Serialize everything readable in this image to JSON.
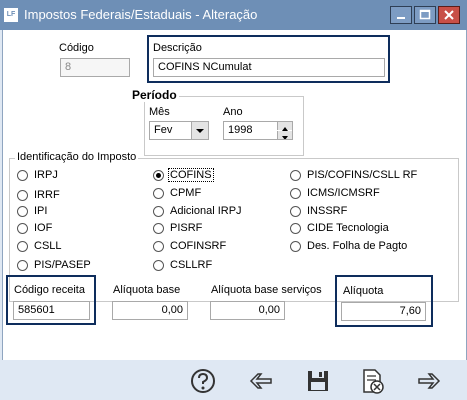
{
  "window": {
    "title": "Impostos Federais/Estaduais - Alteração",
    "app_icon": "LF"
  },
  "codigo": {
    "label": "Código",
    "value": "8"
  },
  "descricao": {
    "label": "Descrição",
    "value": "COFINS NCumulat"
  },
  "periodo": {
    "title": "Período",
    "mes_label": "Mês",
    "mes_value": "Fev",
    "ano_label": "Ano",
    "ano_value": "1998"
  },
  "identificacao": {
    "title": "Identificação do Imposto",
    "selected": "COFINS",
    "col1": [
      "IRPJ",
      "IRRF",
      "IPI",
      "IOF",
      "CSLL",
      "PIS/PASEP"
    ],
    "col2": [
      "COFINS",
      "CPMF",
      "Adicional IRPJ",
      "PISRF",
      "COFINSRF",
      "CSLLRF"
    ],
    "col3": [
      "PIS/COFINS/CSLL RF",
      "ICMS/ICMSRF",
      "INSSRF",
      "CIDE Tecnologia",
      "Des. Folha de Pagto"
    ]
  },
  "codigo_receita": {
    "label": "Código receita",
    "value": "585601"
  },
  "aliquota_base": {
    "label": "Alíquota base",
    "value": "0,00"
  },
  "aliquota_base_servicos": {
    "label": "Alíquota base serviços",
    "value": "0,00"
  },
  "aliquota": {
    "label": "Alíquota",
    "value": "7,60"
  },
  "toolbar_icons": [
    "help-icon",
    "back-arrow-icon",
    "save-icon",
    "delete-document-icon",
    "forward-arrow-icon"
  ],
  "colors": {
    "titlebar": "#6e8fb6",
    "highlight_border": "#0e2d5c",
    "toolbar_bg": "#dfe8f3"
  }
}
